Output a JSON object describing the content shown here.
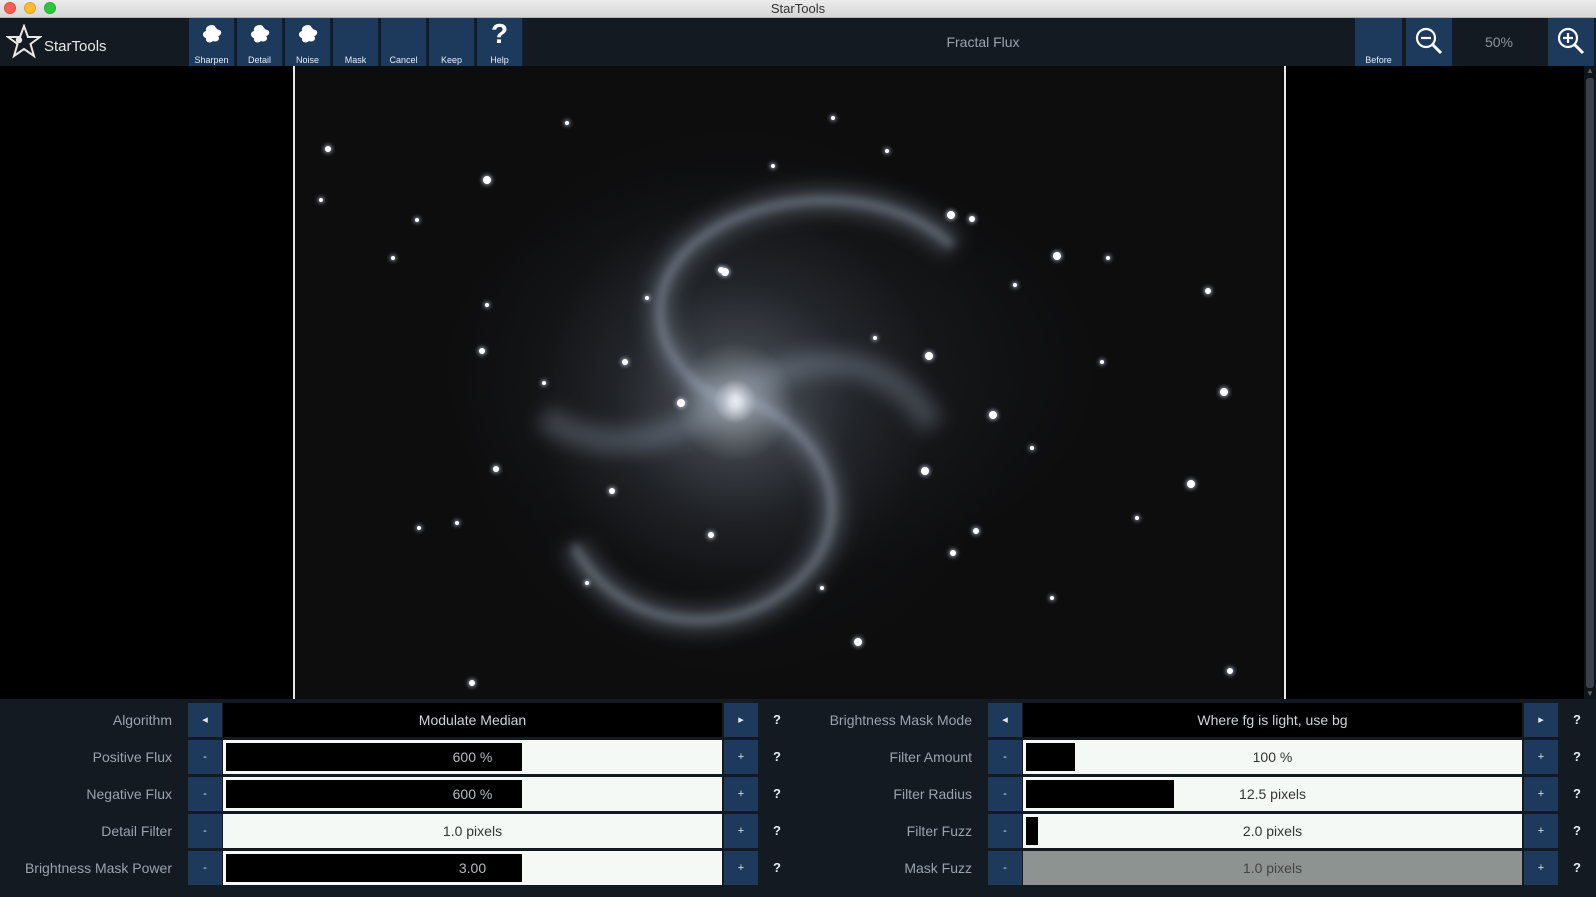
{
  "window": {
    "title": "StarTools"
  },
  "toolbar": {
    "logo_text": "StarTools",
    "buttons": [
      {
        "label": "Sharpen",
        "icon": "blob-icon"
      },
      {
        "label": "Detail",
        "icon": "blob-icon"
      },
      {
        "label": "Noise",
        "icon": "blob-icon"
      },
      {
        "label": "Mask",
        "icon": ""
      },
      {
        "label": "Cancel",
        "icon": ""
      },
      {
        "label": "Keep",
        "icon": ""
      },
      {
        "label": "Help",
        "icon": "question-icon"
      }
    ],
    "tool_title": "Fractal Flux",
    "before_label": "Before",
    "zoom_out_icon": "zoom-out-icon",
    "zoom_level": "50%",
    "zoom_in_icon": "zoom-in-icon"
  },
  "params": {
    "left": [
      {
        "label": "Algorithm",
        "type": "selector",
        "value": "Modulate Median",
        "dec": "◂",
        "inc": "▸"
      },
      {
        "label": "Positive Flux",
        "type": "slider",
        "value": "600 %",
        "level": 0.6,
        "dec": "-",
        "inc": "+"
      },
      {
        "label": "Negative Flux",
        "type": "slider",
        "value": "600 %",
        "level": 0.6,
        "dec": "-",
        "inc": "+"
      },
      {
        "label": "Detail Filter",
        "type": "slider",
        "value": "1.0 pixels",
        "level": 0.0,
        "dec": "-",
        "inc": "+"
      },
      {
        "label": "Brightness Mask Power",
        "type": "slider",
        "value": "3.00",
        "level": 0.6,
        "dec": "-",
        "inc": "+"
      }
    ],
    "right": [
      {
        "label": "Brightness Mask Mode",
        "type": "selector",
        "value": "Where fg is light, use bg",
        "dec": "◂",
        "inc": "▸"
      },
      {
        "label": "Filter Amount",
        "type": "slider",
        "value": "100 %",
        "level": 0.1,
        "dec": "-",
        "inc": "+"
      },
      {
        "label": "Filter Radius",
        "type": "slider",
        "value": "12.5 pixels",
        "level": 0.3,
        "dec": "-",
        "inc": "+"
      },
      {
        "label": "Filter Fuzz",
        "type": "slider",
        "value": "2.0 pixels",
        "level": 0.025,
        "dec": "-",
        "inc": "+"
      },
      {
        "label": "Mask Fuzz",
        "type": "slider",
        "value": "1.0 pixels",
        "level": 0.0,
        "dec": "-",
        "inc": "+",
        "disabled": true
      }
    ],
    "help_label": "?"
  }
}
